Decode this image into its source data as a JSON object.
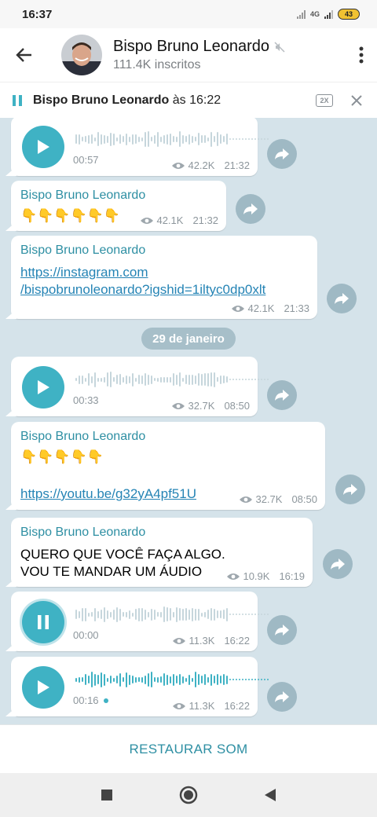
{
  "status": {
    "time": "16:37",
    "network": "4G",
    "battery": "43"
  },
  "header": {
    "title": "Bispo Bruno Leonardo",
    "subtitle": "111.4K inscritos"
  },
  "player": {
    "name": "Bispo Bruno Leonardo",
    "suffix": " às 16:22",
    "speed": "2X"
  },
  "date_divider": "29 de janeiro",
  "messages": [
    {
      "type": "audio",
      "duration": "00:57",
      "views": "42.2K",
      "time": "21:32"
    },
    {
      "type": "text",
      "sender": "Bispo Bruno Leonardo",
      "text": "👇👇👇👇👇👇",
      "views": "42.1K",
      "time": "21:32"
    },
    {
      "type": "link",
      "sender": "Bispo Bruno Leonardo",
      "link_line1": "https://instagram.com",
      "link_line2": "/bispobrunoleonardo?igshid=1iltyc0dp0xlt",
      "views": "42.1K",
      "time": "21:33"
    },
    {
      "type": "audio",
      "duration": "00:33",
      "views": "32.7K",
      "time": "08:50"
    },
    {
      "type": "link",
      "sender": "Bispo Bruno Leonardo",
      "text": "👇👇👇👇👇",
      "link": "https://youtu.be/g32yA4pf51U",
      "views": "32.7K",
      "time": "08:50"
    },
    {
      "type": "text",
      "sender": "Bispo Bruno Leonardo",
      "line1": "QUERO QUE VOCÊ FAÇA ALGO.",
      "line2": "VOU TE MANDAR UM ÁUDIO",
      "views": "10.9K",
      "time": "16:19"
    },
    {
      "type": "audio",
      "state": "playing",
      "duration": "00:00",
      "views": "11.3K",
      "time": "16:22"
    },
    {
      "type": "audio",
      "state": "paused",
      "duration": "00:16",
      "views": "11.3K",
      "time": "16:22"
    }
  ],
  "bottom_action": "RESTAURAR SOM",
  "colors": {
    "accent": "#3fb2c4",
    "chat_bg": "#d5e3ea",
    "link": "#2584b5"
  },
  "icons": [
    "back-arrow-icon",
    "mute-icon",
    "more-vert-icon",
    "pause-icon",
    "close-icon",
    "play-icon",
    "eye-icon",
    "share-icon",
    "square-nav-icon",
    "circle-nav-icon",
    "triangle-back-nav-icon"
  ]
}
